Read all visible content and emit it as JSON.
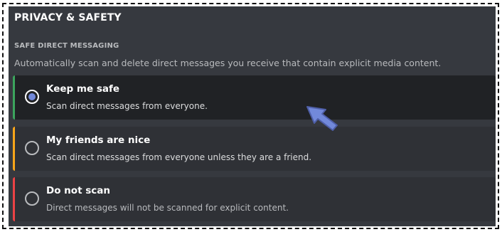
{
  "section": {
    "title": "PRIVACY & SAFETY",
    "subheader": "SAFE DIRECT MESSAGING",
    "description": "Automatically scan and delete direct messages you receive that contain explicit media content."
  },
  "options": [
    {
      "label": "Keep me safe",
      "description": "Scan direct messages from everyone.",
      "selected": true,
      "accent": "#3ba55d"
    },
    {
      "label": "My friends are nice",
      "description": "Scan direct messages from everyone unless they are a friend.",
      "selected": false,
      "accent": "#faa61a"
    },
    {
      "label": "Do not scan",
      "description": "Direct messages will not be scanned for explicit content.",
      "selected": false,
      "accent": "#ed4245"
    }
  ],
  "colors": {
    "background": "#36393f",
    "option_bg": "#2f3136",
    "selected_bg": "#202225",
    "radio_fill": "#7289da",
    "annotation_arrow": "#7289da"
  },
  "icons": {
    "annotation": "arrow-pointer-icon"
  }
}
